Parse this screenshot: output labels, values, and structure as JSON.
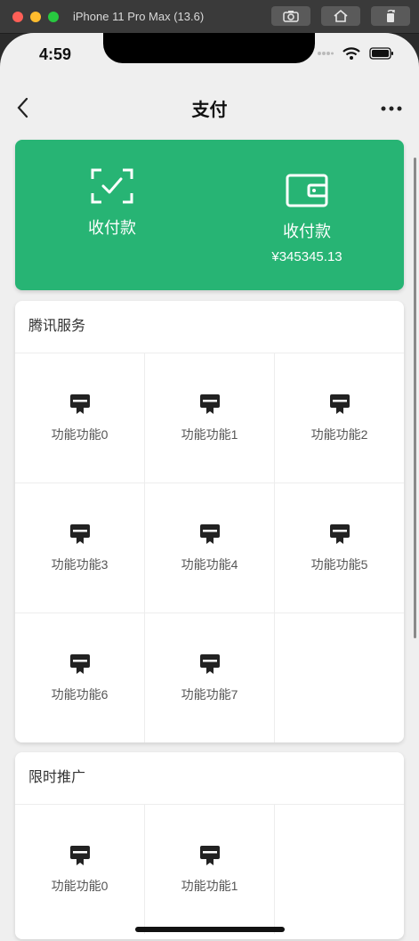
{
  "simulator": {
    "title": "iPhone 11 Pro Max (13.6)"
  },
  "status_bar": {
    "time": "4:59"
  },
  "navbar": {
    "title": "支付"
  },
  "green_card": {
    "left": {
      "label": "收付款",
      "icon": "scan-check-icon"
    },
    "right": {
      "label": "收付款",
      "amount": "¥345345.13",
      "icon": "wallet-icon"
    },
    "color": "#27b474"
  },
  "sections": [
    {
      "title": "腾讯服务",
      "items": [
        "功能功能0",
        "功能功能1",
        "功能功能2",
        "功能功能3",
        "功能功能4",
        "功能功能5",
        "功能功能6",
        "功能功能7"
      ]
    },
    {
      "title": "限时推广",
      "items": [
        "功能功能0",
        "功能功能1"
      ]
    }
  ]
}
